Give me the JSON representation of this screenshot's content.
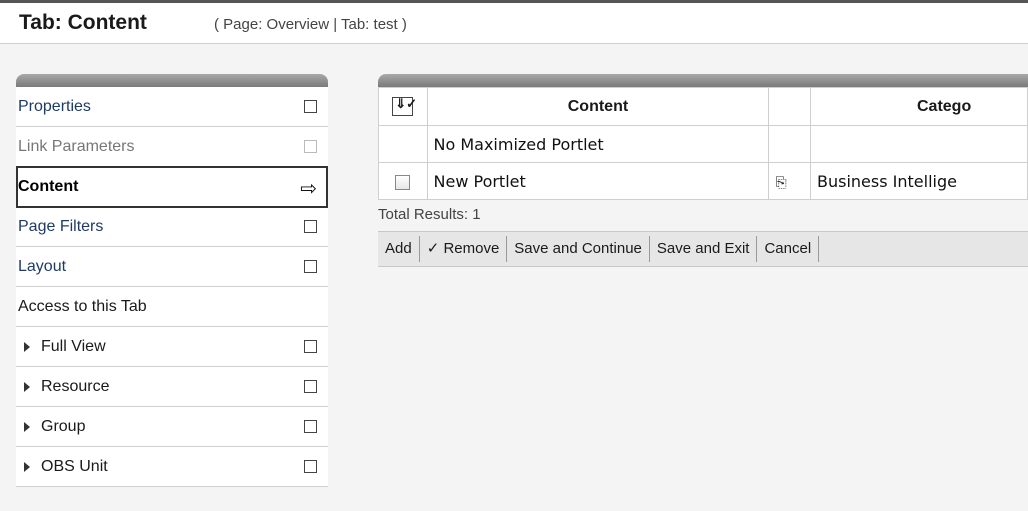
{
  "header": {
    "title": "Tab: Content",
    "breadcrumb": "( Page: Overview | Tab: test )"
  },
  "menu": {
    "items": [
      {
        "label": "Properties"
      },
      {
        "label": "Link Parameters"
      },
      {
        "label": "Content",
        "arrow": "⇨"
      },
      {
        "label": "Page Filters"
      },
      {
        "label": "Layout"
      },
      {
        "label": "Access to this Tab"
      },
      {
        "label": "Full View"
      },
      {
        "label": "Resource"
      },
      {
        "label": "Group"
      },
      {
        "label": "OBS Unit"
      }
    ]
  },
  "grid": {
    "columns": [
      "Content",
      "Catego"
    ],
    "sort_icon": "⇓✓",
    "rows": [
      {
        "content": "No Maximized Portlet",
        "category": ""
      },
      {
        "content": "New Portlet",
        "category": "Business Intellige",
        "icon": "⎘"
      }
    ],
    "total": "Total Results: 1"
  },
  "toolbar": {
    "add": "Add",
    "remove": "✓ Remove",
    "save_continue": "Save and Continue",
    "save_exit": "Save and Exit",
    "cancel": "Cancel"
  }
}
